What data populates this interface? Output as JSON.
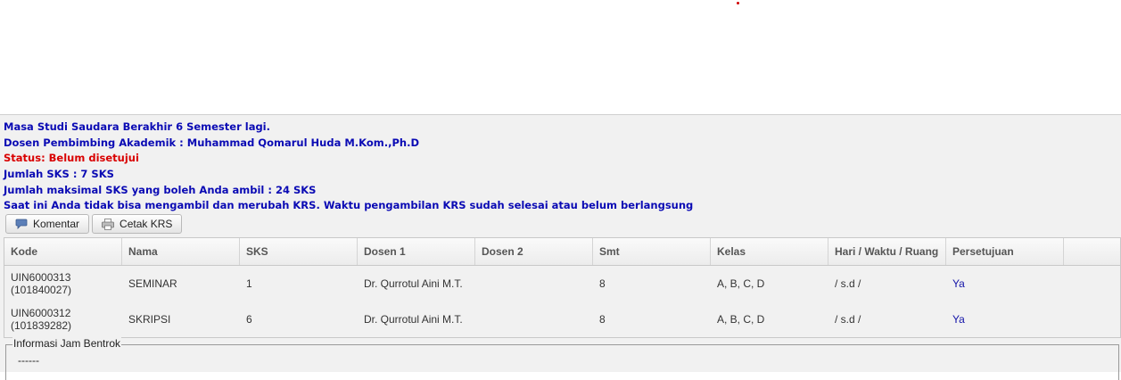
{
  "info": {
    "masa_studi": "Masa Studi Saudara Berakhir 6 Semester lagi.",
    "dosen_pembimbing": "Dosen Pembimbing Akademik : Muhammad Qomarul Huda M.Kom.,Ph.D",
    "status": "Status: Belum disetujui",
    "jumlah_sks": "Jumlah SKS : 7 SKS",
    "maks_sks": "Jumlah maksimal SKS yang boleh Anda ambil : 24 SKS",
    "notice": "Saat ini Anda tidak bisa mengambil dan merubah KRS. Waktu pengambilan KRS sudah selesai atau belum berlangsung"
  },
  "toolbar": {
    "komentar_label": "Komentar",
    "komentar_icon": "comment-icon",
    "cetak_label": "Cetak KRS",
    "cetak_icon": "printer-icon"
  },
  "table": {
    "headers": [
      "Kode",
      "Nama",
      "SKS",
      "Dosen 1",
      "Dosen 2",
      "Smt",
      "Kelas",
      "Hari / Waktu / Ruang",
      "Persetujuan"
    ],
    "rows": [
      {
        "kode": "UIN6000313",
        "kode_sub": "(101840027)",
        "nama": "SEMINAR",
        "sks": "1",
        "dosen1": "Dr. Qurrotul Aini M.T.",
        "dosen2": "",
        "smt": "8",
        "kelas": "A, B, C, D",
        "jadwal": "/ s.d /",
        "persetujuan": "Ya"
      },
      {
        "kode": "UIN6000312",
        "kode_sub": "(101839282)",
        "nama": "SKRIPSI",
        "sks": "6",
        "dosen1": "Dr. Qurrotul Aini M.T.",
        "dosen2": "",
        "smt": "8",
        "kelas": "A, B, C, D",
        "jadwal": "/ s.d /",
        "persetujuan": "Ya"
      }
    ]
  },
  "bentrok": {
    "legend": "Informasi Jam Bentrok",
    "content": "------"
  },
  "colors": {
    "info_text": "#0a0ab4",
    "status_text": "#d90000",
    "link_text": "#1414a8",
    "panel_bg": "#f1f1f1"
  }
}
